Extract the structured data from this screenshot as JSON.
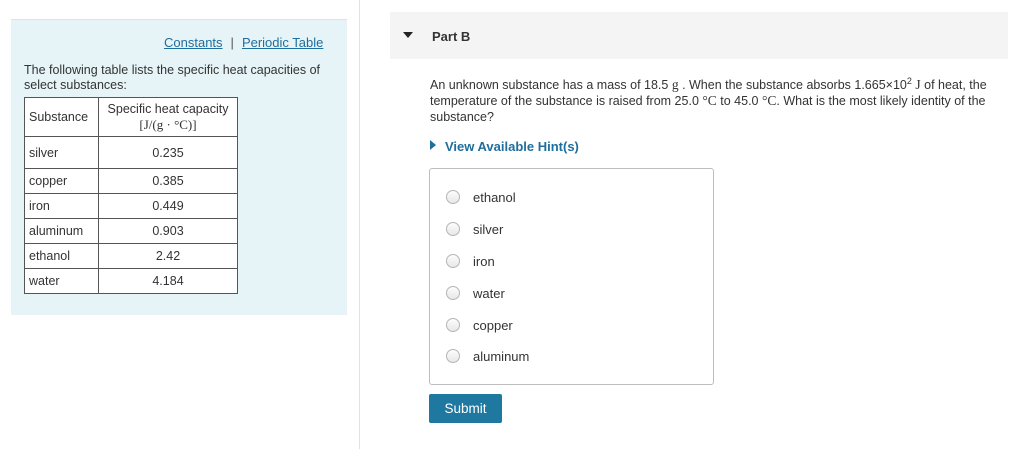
{
  "links": {
    "constants": "Constants",
    "separator": "|",
    "periodic_table": "Periodic Table"
  },
  "intro": "The following table lists the specific heat capacities of select substances:",
  "table": {
    "header_substance": "Substance",
    "header_capacity": "Specific heat capacity",
    "header_unit": "[J/(g · °C)]",
    "rows": [
      {
        "substance": "silver",
        "value": "0.235"
      },
      {
        "substance": "copper",
        "value": "0.385"
      },
      {
        "substance": "iron",
        "value": "0.449"
      },
      {
        "substance": "aluminum",
        "value": "0.903"
      },
      {
        "substance": "ethanol",
        "value": "2.42"
      },
      {
        "substance": "water",
        "value": "4.184"
      }
    ]
  },
  "part": {
    "title": "Part B",
    "toggle_icon": "triangle-down-icon"
  },
  "question": {
    "t1": "An unknown substance has a mass of 18.5",
    "u1": "g",
    "t2": ". When the substance absorbs 1.665×10",
    "exp": "2",
    "u2": "J",
    "t3": "of heat, the temperature of the substance is raised from 25.0",
    "u3": "°C",
    "t4": "to 45.0",
    "u4": "°C",
    "t5": ". What is the most likely identity of the substance?"
  },
  "hints": {
    "label": "View Available Hint(s)",
    "icon": "triangle-right-icon"
  },
  "options": [
    "ethanol",
    "silver",
    "iron",
    "water",
    "copper",
    "aluminum"
  ],
  "submit": {
    "label": "Submit"
  },
  "colors": {
    "accent": "#1f78a0",
    "link": "#1f6e9c",
    "panel_bg": "#e6f4f7"
  }
}
